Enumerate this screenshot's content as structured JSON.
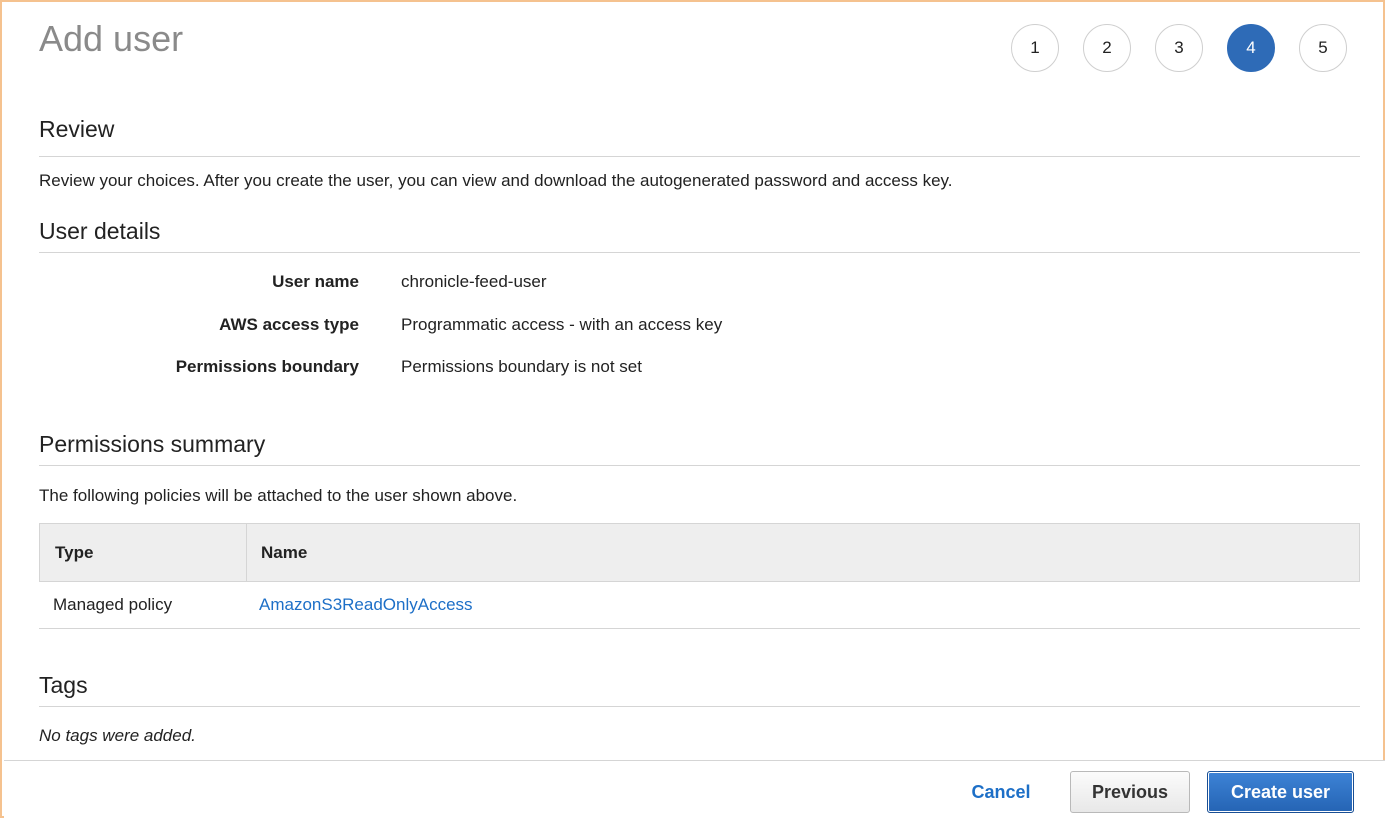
{
  "page": {
    "title": "Add user"
  },
  "wizard": {
    "steps": [
      "1",
      "2",
      "3",
      "4",
      "5"
    ],
    "active_step": 4,
    "active_color": "#2e6bb7"
  },
  "review": {
    "title": "Review",
    "description": "Review your choices. After you create the user, you can view and download the autogenerated password and access key."
  },
  "user_details": {
    "title": "User details",
    "rows": [
      {
        "label": "User name",
        "value": "chronicle-feed-user"
      },
      {
        "label": "AWS access type",
        "value": "Programmatic access - with an access key"
      },
      {
        "label": "Permissions boundary",
        "value": "Permissions boundary is not set"
      }
    ]
  },
  "permissions_summary": {
    "title": "Permissions summary",
    "description": "The following policies will be attached to the user shown above.",
    "columns": [
      "Type",
      "Name"
    ],
    "rows": [
      {
        "type": "Managed policy",
        "name": "AmazonS3ReadOnlyAccess"
      }
    ],
    "link_color": "#1d6fc7"
  },
  "tags": {
    "title": "Tags",
    "empty_text": "No tags were added."
  },
  "footer": {
    "cancel_label": "Cancel",
    "previous_label": "Previous",
    "create_label": "Create user"
  }
}
